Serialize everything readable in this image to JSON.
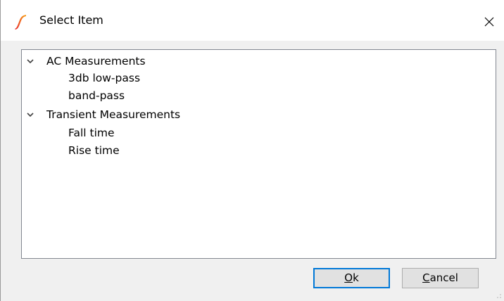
{
  "window": {
    "title": "Select Item",
    "icon": "spice-app-icon",
    "close_icon": "close-icon"
  },
  "tree": {
    "groups": [
      {
        "label": "AC Measurements",
        "expanded": true,
        "items": [
          "3db low-pass",
          "band-pass"
        ]
      },
      {
        "label": "Transient Measurements",
        "expanded": true,
        "items": [
          "Fall time",
          "Rise time"
        ]
      }
    ]
  },
  "buttons": {
    "ok": {
      "mnemonic": "O",
      "rest": "k"
    },
    "cancel": {
      "mnemonic": "C",
      "rest": "ancel"
    }
  },
  "colors": {
    "app_icon_red": "#e8262b",
    "app_icon_orange": "#f7a21b",
    "default_button_border": "#0078d7"
  }
}
